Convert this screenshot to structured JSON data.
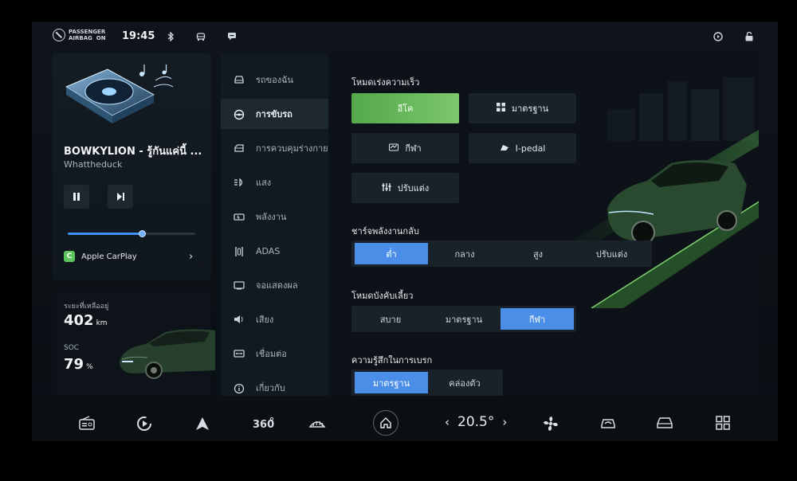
{
  "status": {
    "airbag_text": "PASSENGER\nAIRBAG  ON",
    "time": "19:45"
  },
  "music": {
    "title": "BOWKYLION - รู้กันแค่นี้ ...",
    "artist": "Whattheduck",
    "progress": 0.58,
    "source": "Apple CarPlay"
  },
  "range": {
    "remaining_label": "ระยะที่เหลืออยู่",
    "remaining_value": "402",
    "remaining_unit": "km",
    "soc_label": "SOC",
    "soc_value": "79",
    "soc_unit": "%"
  },
  "menu": {
    "items": [
      {
        "label": "รถของฉัน",
        "icon": "car-icon"
      },
      {
        "label": "การขับรถ",
        "icon": "steering-wheel-icon"
      },
      {
        "label": "การควบคุมร่างกาย",
        "icon": "car-body-icon"
      },
      {
        "label": "แสง",
        "icon": "headlight-icon"
      },
      {
        "label": "พลังงาน",
        "icon": "battery-icon"
      },
      {
        "label": "ADAS",
        "icon": "lane-assist-icon"
      },
      {
        "label": "จอแสดงผล",
        "icon": "display-icon"
      },
      {
        "label": "เสียง",
        "icon": "speaker-icon"
      },
      {
        "label": "เชื่อมต่อ",
        "icon": "connect-icon"
      },
      {
        "label": "เกี่ยวกับ",
        "icon": "info-icon"
      }
    ],
    "active_index": 1
  },
  "drive_mode": {
    "title": "โหมดเร่งความเร็ว",
    "tiles": [
      {
        "label": "อีโค",
        "selected": true
      },
      {
        "label": "มาตรฐาน",
        "selected": false,
        "icon": "grid-icon"
      },
      {
        "label": "กีฬา",
        "selected": false,
        "icon": "sport-icon"
      },
      {
        "label": "I-pedal",
        "selected": false,
        "icon": "pedal-icon"
      },
      {
        "label": "ปรับแต่ง",
        "selected": false,
        "icon": "sliders-icon"
      }
    ],
    "accent": "#6bbd5e"
  },
  "regen": {
    "title": "ชาร์จพลังงานกลับ",
    "options": [
      "ต่ำ",
      "กลาง",
      "สูง",
      "ปรับแต่ง"
    ],
    "selected": "ต่ำ"
  },
  "steering": {
    "title": "โหมดบังคับเลี้ยว",
    "options": [
      "สบาย",
      "มาตรฐาน",
      "กีฬา"
    ],
    "selected": "กีฬา"
  },
  "brake": {
    "title": "ความรู้สึกในการเบรก",
    "options": [
      "มาตรฐาน",
      "คล่องตัว"
    ],
    "selected": "มาตรฐาน"
  },
  "dock": {
    "temperature": "20.5",
    "temperature_unit": "°"
  },
  "colors": {
    "accent_blue": "#4a8ee8",
    "accent_green": "#6bbd5e"
  }
}
